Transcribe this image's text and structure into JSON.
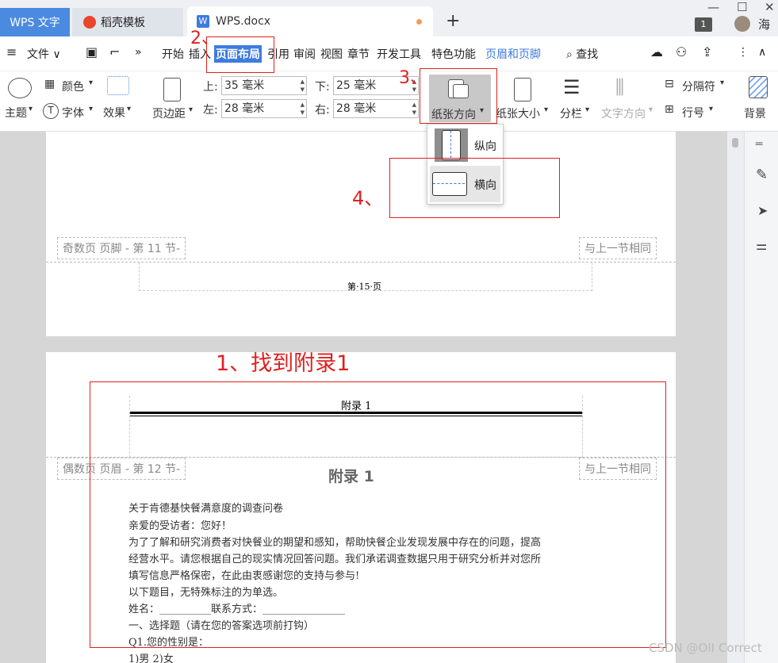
{
  "tabs": {
    "wps": "WPS 文字",
    "daoke": "稻壳模板",
    "doc": "WPS.docx",
    "badge": "1",
    "user": "海"
  },
  "menu": {
    "file": "文件",
    "items": [
      "开始",
      "插入",
      "页面布局",
      "引用",
      "审阅",
      "视图",
      "章节",
      "开发工具",
      "特色功能",
      "页眉和页脚"
    ],
    "find": "查找"
  },
  "ribbon": {
    "theme": "主题",
    "color": "颜色",
    "font": "字体",
    "effect": "效果",
    "margins": "页边距",
    "top_label": "上:",
    "top_value": "35 毫米",
    "bottom_label": "下:",
    "bottom_value": "25 毫米",
    "left_label": "左:",
    "left_value": "28 毫米",
    "right_label": "右:",
    "right_value": "28 毫米",
    "orientation": "纸张方向",
    "size": "纸张大小",
    "columns": "分栏",
    "text_direction": "文字方向",
    "breaks": "分隔符",
    "line_numbers": "行号",
    "background": "背景"
  },
  "orientation_menu": {
    "portrait": "纵向",
    "landscape": "横向"
  },
  "page1": {
    "footer_tag": "奇数页 页脚 - 第 11 节-",
    "same_as_prev": "与上一节相同",
    "page_number": "第·15·页"
  },
  "page2": {
    "header_text": "附录 1",
    "header_tag": "偶数页 页眉 - 第 12 节-",
    "same_as_prev": "与上一节相同",
    "title": "附录 1",
    "lines": [
      "关于肯德基快餐满意度的调查问卷",
      "亲爱的受访者：您好！",
      "为了了解和研究消费者对快餐业的期望和感知，帮助快餐企业发现发展中存在的问题，提高",
      "经营水平。请您根据自己的现实情况回答问题。我们承诺调查数据只用于研究分析并对您所",
      "填写信息严格保密，在此由衷感谢您的支持与参与!",
      "以下题目，无特殊标注的为单选。",
      "姓名：__________联系方式：________________",
      "一、选择题（请在您的答案选项前打钩）",
      "Q1.您的性别是：",
      "1)男 2)女"
    ]
  },
  "annotations": {
    "step1": "1、找到附录1",
    "step2": "2、",
    "step3": "3、",
    "step4": "4、",
    "color": "#e02020"
  },
  "watermark": "CSDN @OII Correct",
  "colors": {
    "accent": "#3d7be0",
    "wps_tab": "#4a8be0"
  }
}
